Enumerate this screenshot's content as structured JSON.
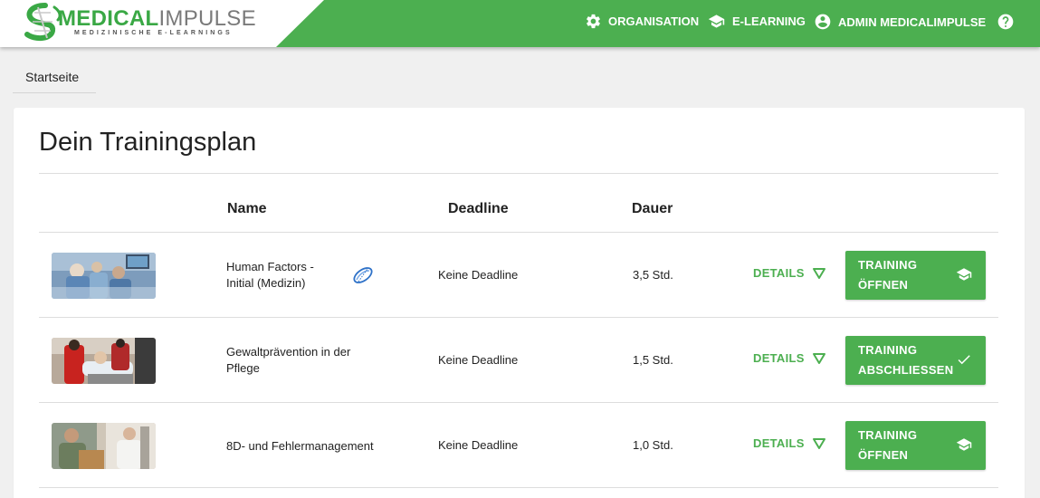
{
  "brand": {
    "name_part1": "MEDICAL",
    "name_part2": "IMPULSE",
    "tagline": "MEDIZINISCHE E-LEARNINGS",
    "color": "#4caf50"
  },
  "nav": {
    "organisation": "ORGANISATION",
    "elearning": "E-LEARNING",
    "user": "ADMIN MEDICALIMPULSE",
    "icons": [
      "gear-icon",
      "graduation-cap-icon",
      "account-circle-icon",
      "help-circle-icon"
    ]
  },
  "breadcrumb": {
    "home": "Startseite"
  },
  "plan": {
    "title": "Dein Trainingsplan",
    "columns": {
      "name": "Name",
      "deadline": "Deadline",
      "duration": "Dauer"
    },
    "rows": [
      {
        "name_line1": "Human Factors -",
        "name_line2": "Initial (Medizin)",
        "deadline": "Keine Deadline",
        "duration": "3,5 Std.",
        "details": "DETAILS",
        "action_line1": "TRAINING",
        "action_line2": "ÖFFNEN",
        "action_icon": "graduation-cap-icon"
      },
      {
        "name_line1": "Gewaltprävention in der",
        "name_line2": "Pflege",
        "deadline": "Keine Deadline",
        "duration": "1,5 Std.",
        "details": "DETAILS",
        "action_line1": "TRAINING",
        "action_line2": "ABSCHLIESSEN",
        "action_icon": "check-icon"
      },
      {
        "name_line1": "8D- und Fehlermanagement",
        "name_line2": "",
        "deadline": "Keine Deadline",
        "duration": "1,0 Std.",
        "details": "DETAILS",
        "action_line1": "TRAINING",
        "action_line2": "ÖFFNEN",
        "action_icon": "graduation-cap-icon"
      }
    ]
  }
}
